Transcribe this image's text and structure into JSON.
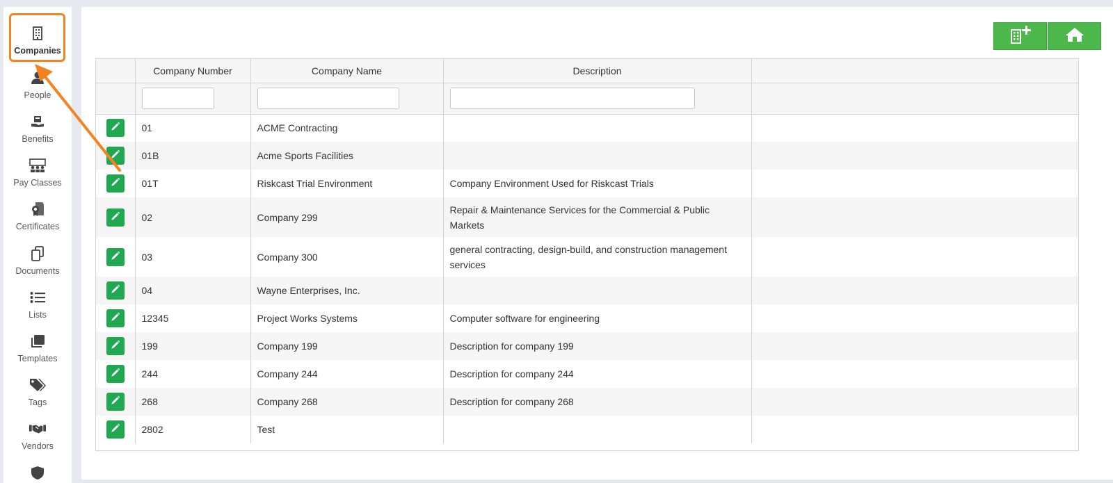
{
  "sidebar": {
    "items": [
      {
        "label": "Companies",
        "icon": "building-icon"
      },
      {
        "label": "People",
        "icon": "person-icon"
      },
      {
        "label": "Benefits",
        "icon": "benefits-icon"
      },
      {
        "label": "Pay Classes",
        "icon": "group-icon"
      },
      {
        "label": "Certificates",
        "icon": "certificate-icon"
      },
      {
        "label": "Documents",
        "icon": "documents-icon"
      },
      {
        "label": "Lists",
        "icon": "list-icon"
      },
      {
        "label": "Templates",
        "icon": "templates-icon"
      },
      {
        "label": "Tags",
        "icon": "tags-icon"
      },
      {
        "label": "Vendors",
        "icon": "handshake-icon"
      }
    ],
    "active": "Companies"
  },
  "toolbar": {
    "add_company_icon": "building-plus-icon",
    "home_icon": "home-icon"
  },
  "table": {
    "columns": [
      "Company Number",
      "Company Name",
      "Description"
    ],
    "rows": [
      {
        "number": "01",
        "name": "ACME Contracting",
        "description": ""
      },
      {
        "number": "01B",
        "name": "Acme Sports Facilities",
        "description": ""
      },
      {
        "number": "01T",
        "name": "Riskcast Trial Environment",
        "description": "Company Environment Used for Riskcast Trials"
      },
      {
        "number": "02",
        "name": "Company 299",
        "description": "Repair & Maintenance Services for the Commercial & Public Markets"
      },
      {
        "number": "03",
        "name": "Company 300",
        "description": "general contracting, design-build, and construction management services"
      },
      {
        "number": "04",
        "name": "Wayne Enterprises, Inc.",
        "description": ""
      },
      {
        "number": "12345",
        "name": "Project Works Systems",
        "description": "Computer software for engineering"
      },
      {
        "number": "199",
        "name": "Company 199",
        "description": "Description for company 199"
      },
      {
        "number": "244",
        "name": "Company 244",
        "description": "Description for company 244"
      },
      {
        "number": "268",
        "name": "Company 268",
        "description": "Description for company 268"
      },
      {
        "number": "2802",
        "name": "Test",
        "description": ""
      }
    ]
  },
  "colors": {
    "accent_green": "#1fa84f",
    "button_green": "#4cb84c",
    "highlight_orange": "#f5811f"
  }
}
